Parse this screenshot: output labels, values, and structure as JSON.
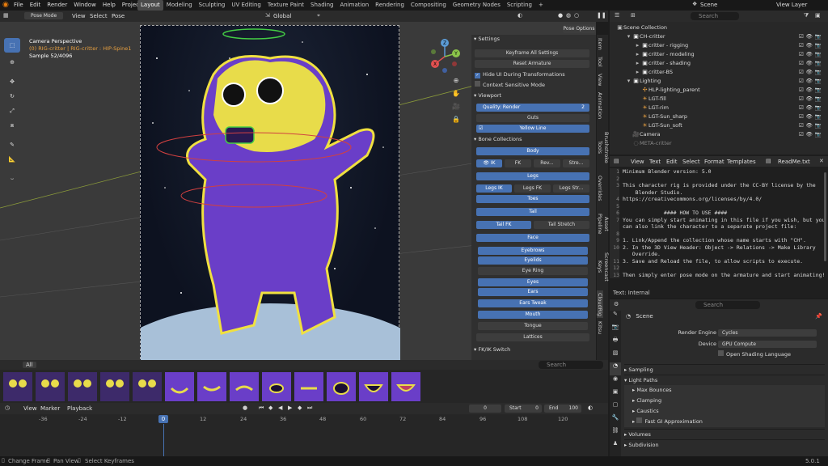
{
  "topbar": {
    "menus": [
      "File",
      "Edit",
      "Render",
      "Window",
      "Help",
      "Project"
    ],
    "workspaces": [
      "Layout",
      "Modeling",
      "Sculpting",
      "UV Editing",
      "Texture Paint",
      "Shading",
      "Animation",
      "Rendering",
      "Compositing",
      "Geometry Nodes",
      "Scripting"
    ],
    "active_workspace": "Layout",
    "scene": "Scene",
    "view_layer": "View Layer"
  },
  "viewport": {
    "mode": "Pose Mode",
    "menus": [
      "View",
      "Select",
      "Pose"
    ],
    "orientation": "Global",
    "pose_options": "Pose Options",
    "info": [
      "Camera Perspective",
      "(0) RIG-critter | RIG-critter : HIP-Spine1",
      "Sample 52/4096"
    ],
    "gizmo": {
      "z": "Z",
      "y": "Y",
      "x": "X"
    }
  },
  "npanel": {
    "settings_header": "Settings",
    "keyframe_all": "Keyframe All Settings",
    "reset_armature": "Reset Armature",
    "hide_ui": "Hide UI During Transformations",
    "context_mode": "Context Sensitive Mode",
    "viewport_header": "Viewport",
    "quality_label": "Quality: Render",
    "quality_value": "2",
    "guts": "Guts",
    "yellow_line": "Yellow Line",
    "bone_collections_header": "Bone Collections",
    "body": "Body",
    "ik": "IK",
    "fk": "FK",
    "rev": "Rev...",
    "stre": "Stre...",
    "legs": "Legs",
    "legs_ik": "Legs IK",
    "legs_fk": "Legs FK",
    "legs_str": "Legs Str...",
    "toes": "Toes",
    "tail": "Tail",
    "tail_fk": "Tail FK",
    "tail_stretch": "Tail Stretch",
    "face": "Face",
    "eyebrows": "Eyebrows",
    "eyelids": "Eyelids",
    "eye_ring": "Eye Ring",
    "eyes": "Eyes",
    "ears": "Ears",
    "ears_tweak": "Ears Tweak",
    "mouth": "Mouth",
    "tongue": "Tongue",
    "lattices": "Lattices",
    "fkik_header": "FK/IK Switch",
    "tabs": [
      "Item",
      "Tool",
      "View",
      "Animation",
      "Brushstroke Tools",
      "Overrides",
      "Asset Pipeline",
      "Screencast Keys",
      "CloudRig",
      "Kitsu"
    ]
  },
  "outliner": {
    "search_placeholder": "Search",
    "root": "Scene Collection",
    "items": [
      {
        "label": "CH-critter",
        "indent": 1,
        "type": "coll"
      },
      {
        "label": "critter - rigging",
        "indent": 2,
        "type": "coll"
      },
      {
        "label": "critter - modeling",
        "indent": 2,
        "type": "coll"
      },
      {
        "label": "critter - shading",
        "indent": 2,
        "type": "coll"
      },
      {
        "label": "critter-BS",
        "indent": 2,
        "type": "coll"
      },
      {
        "label": "Lighting",
        "indent": 1,
        "type": "coll"
      },
      {
        "label": "HLP-lighting_parent",
        "indent": 2,
        "type": "obj"
      },
      {
        "label": "LGT-fill",
        "indent": 2,
        "type": "light"
      },
      {
        "label": "LGT-rim",
        "indent": 2,
        "type": "light"
      },
      {
        "label": "LGT-Sun_sharp",
        "indent": 2,
        "type": "light"
      },
      {
        "label": "LGT-Sun_soft",
        "indent": 2,
        "type": "light"
      },
      {
        "label": "Camera",
        "indent": 1,
        "type": "cam"
      },
      {
        "label": "META-critter",
        "indent": 1,
        "type": "meta"
      }
    ]
  },
  "text_editor": {
    "menus": [
      "View",
      "Text",
      "Edit",
      "Select",
      "Format",
      "Templates"
    ],
    "filename": "ReadMe.txt",
    "lines": [
      "Minimum Blender version: 5.0",
      "",
      "This character rig is provided under the CC-BY license by the",
      "    Blender Studio.",
      "https://creativecommons.org/licenses/by/4.0/",
      "",
      "             #### HOW TO USE ####",
      "You can simply start animating in this file if you wish, but you",
      "can also link the character to a separate project file:",
      "",
      "1. Link/Append the collection whose name starts with \"CH\".",
      "2. In the 3D View Header: Object -> Relations -> Make Library",
      "   Override.",
      "3. Save and Reload the file, to allow scripts to execute.",
      "",
      "Then simply enter pose mode on the armature and start animating!"
    ],
    "line_numbers": [
      "1",
      "2",
      "3",
      "",
      "4",
      "5",
      "6",
      "7",
      "",
      "8",
      "9",
      "10",
      "",
      "11",
      "12",
      "13"
    ],
    "footer": "Text: Internal"
  },
  "properties": {
    "search_placeholder": "Search",
    "context": "Scene",
    "render_engine_label": "Render Engine",
    "render_engine": "Cycles",
    "device_label": "Device",
    "device": "GPU Compute",
    "osl": "Open Shading Language",
    "sections": [
      "Sampling",
      "Light Paths",
      "Max Bounces",
      "Clamping",
      "Caustics",
      "Fast GI Approximation",
      "Volumes",
      "Subdivision"
    ]
  },
  "asset_shelf": {
    "tab": "All",
    "search_placeholder": "Search"
  },
  "timeline": {
    "menus": [
      "View",
      "Marker",
      "Playback"
    ],
    "start_label": "Start",
    "start": "0",
    "end_label": "End",
    "end": "100",
    "current": "0",
    "ticks": [
      "-36",
      "-24",
      "-12",
      "0",
      "12",
      "24",
      "36",
      "48",
      "60",
      "72",
      "84",
      "96",
      "108",
      "120"
    ]
  },
  "statusbar": {
    "items": [
      "Change Frame",
      "Pan View",
      "Select Keyframes"
    ],
    "version": "5.0.1"
  }
}
